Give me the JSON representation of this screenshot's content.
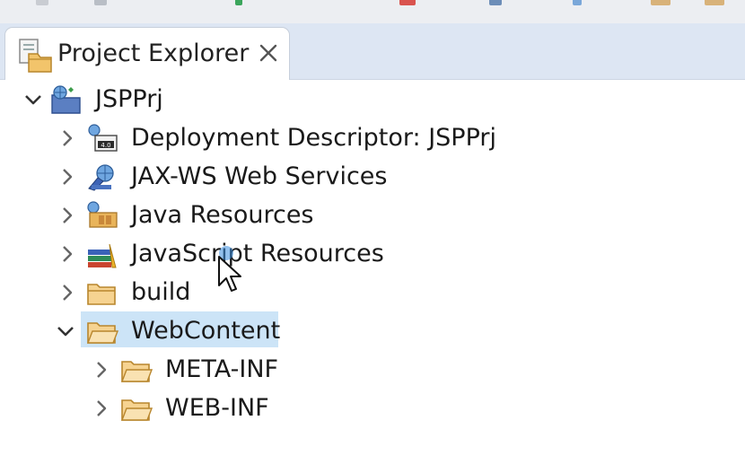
{
  "panel": {
    "tab_title": "Project Explorer",
    "tab_icon": "project-explorer-icon",
    "close_icon": "close-x-icon"
  },
  "tree": {
    "root": {
      "label": "JSPPrj",
      "icon": "dynamic-web-project-icon",
      "expanded": true
    },
    "children": [
      {
        "label": "Deployment Descriptor: JSPPrj",
        "icon": "deployment-descriptor-icon",
        "expanded": false
      },
      {
        "label": "JAX-WS Web Services",
        "icon": "web-services-icon",
        "expanded": false
      },
      {
        "label": "Java Resources",
        "icon": "java-resources-icon",
        "expanded": false
      },
      {
        "label": "JavaScript Resources",
        "icon": "javascript-resources-icon",
        "expanded": false
      },
      {
        "label": "build",
        "icon": "folder-icon",
        "expanded": false
      },
      {
        "label": "WebContent",
        "icon": "folder-open-icon",
        "expanded": true,
        "selected": true
      }
    ],
    "webcontent_children": [
      {
        "label": "META-INF",
        "icon": "folder-icon",
        "expanded": false
      },
      {
        "label": "WEB-INF",
        "icon": "folder-icon",
        "expanded": false
      }
    ]
  },
  "colors": {
    "selection": "#cce4f7",
    "tab_strip": "#dde6f3",
    "folder": "#e9b45a"
  }
}
